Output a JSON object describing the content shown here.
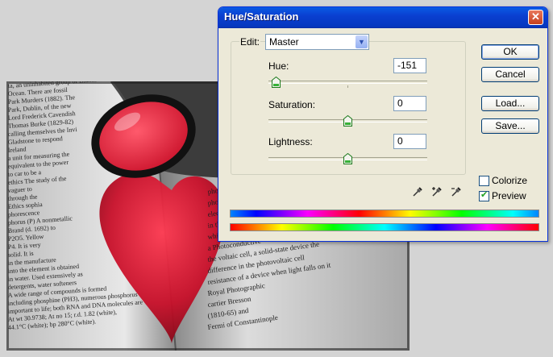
{
  "dialog": {
    "title": "Hue/Saturation",
    "close_icon": "close-icon",
    "edit": {
      "label": "Edit:",
      "selected": "Master"
    },
    "sliders": [
      {
        "key": "hue",
        "label": "Hue:",
        "value": "-151",
        "fraction": 0.05
      },
      {
        "key": "saturation",
        "label": "Saturation:",
        "value": "0",
        "fraction": 0.5
      },
      {
        "key": "lightness",
        "label": "Lightness:",
        "value": "0",
        "fraction": 0.5
      }
    ],
    "buttons": {
      "ok": "OK",
      "cancel": "Cancel",
      "load": "Load...",
      "save": "Save..."
    },
    "checkboxes": {
      "colorize": {
        "label": "Colorize",
        "checked": false
      },
      "preview": {
        "label": "Preview",
        "checked": true
      }
    },
    "tools": [
      "eyedropper-icon",
      "eyedropper-plus-icon",
      "eyedropper-minus-icon"
    ],
    "colors": {
      "title_bar": "#0a46d6",
      "dialog_bg": "#ece9d8",
      "input_border": "#7f9db9"
    }
  },
  "photo": {
    "subject": "open-dictionary-with-magnifier-heart-image",
    "text_lines": [
      "ta, an uninhabited group of islands",
      "Ocean. There are fossil",
      "Park Murders (1882). The",
      "Park, Dublin, of the new",
      "Lord Frederick Cavendish",
      "Thomas Burke (1829-82)",
      "calling themselves the Invi",
      "Gladstone to respond",
      "Ireland",
      "a unit for measuring the",
      "equivalent to the power",
      "to car to be a",
      "ethics The study of the",
      "vaguer to",
      "through the",
      "Ethics sophia",
      "phorescence",
      "phorus (P) A nonmetallic",
      "Brand (d. 1692) to",
      "P2O5. Yellow",
      "P4. It is very",
      "solid. It is",
      "in the manufacture",
      "into the element is obtained",
      "in water. Used extensively as",
      "detergents, water softeners",
      "A wide range of compounds is formed",
      "including phosphine (PH3), numerous phosphorus",
      "important to life; both RNA and DNA molecules are",
      "At wt 30.9738; At no 15; r.d. 1.82 (white),",
      "44.1°C (white); bp 280°C (white).",
      "photocell Illumination increases the conductivity",
      "photoelectric cell A device that makes use",
      "electrical current or measure or detect light or other",
      "in the photoemissive cell, a",
      "which electrons when it is illuminated",
      "a Photoconductive",
      "the voltaic cell, a solid-state device the",
      "difference in the photovoltaic cell",
      "resistance of a device when light falls on it",
      "Royal Photographic",
      "cartier Bresson",
      "(1810-65) and",
      "Fermi of Constantinople"
    ]
  }
}
